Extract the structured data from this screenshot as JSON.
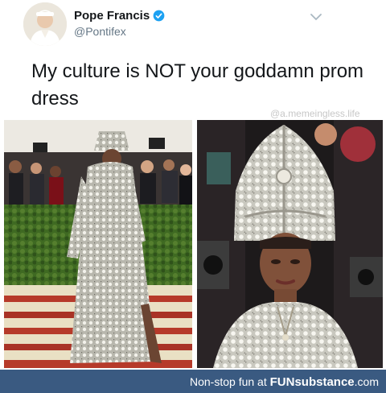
{
  "tweet": {
    "display_name": "Pope Francis",
    "handle": "@Pontifex",
    "text": "My culture is NOT your goddamn prom dress"
  },
  "watermark": "@a.memeingless.life",
  "footer": {
    "prefix": "Non-stop fun at ",
    "brand": "FUNsubstance",
    "suffix": ".com"
  },
  "colors": {
    "verified": "#1da1f2",
    "footer_bg": "#3a5a81",
    "text": "#14171a",
    "handle": "#657786"
  },
  "icons": [
    "verified-badge-icon",
    "chevron-down-icon"
  ]
}
